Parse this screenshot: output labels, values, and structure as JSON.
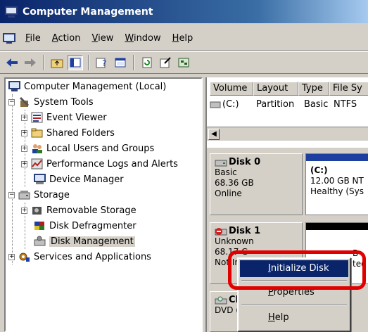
{
  "window": {
    "title": "Computer Management"
  },
  "menu": [
    {
      "label": "File",
      "key": "F",
      "rest": "ile"
    },
    {
      "label": "Action",
      "key": "A",
      "rest": "ction"
    },
    {
      "label": "View",
      "key": "V",
      "rest": "iew"
    },
    {
      "label": "Window",
      "key": "W",
      "rest": "indow"
    },
    {
      "label": "Help",
      "key": "H",
      "rest": "elp"
    }
  ],
  "toolbar": {
    "icons": [
      "back-icon",
      "forward-icon",
      "up-folder-icon",
      "show-hide-tree-icon",
      "help-icon",
      "properties-icon",
      "refresh-icon",
      "export-icon",
      "console-icon"
    ]
  },
  "tree": {
    "root": "Computer Management (Local)",
    "system_tools": "System Tools",
    "event_viewer": "Event Viewer",
    "shared_folders": "Shared Folders",
    "local_users": "Local Users and Groups",
    "perf_logs": "Performance Logs and Alerts",
    "device_manager": "Device Manager",
    "storage": "Storage",
    "removable_storage": "Removable Storage",
    "disk_defrag": "Disk Defragmenter",
    "disk_management": "Disk Management",
    "services": "Services and Applications"
  },
  "volume_list": {
    "columns": [
      "Volume",
      "Layout",
      "Type",
      "File Sy"
    ],
    "rows": [
      {
        "volume": "(C:)",
        "layout": "Partition",
        "type": "Basic",
        "fs": "NTFS"
      }
    ]
  },
  "disks": {
    "disk0": {
      "name": "Disk 0",
      "type": "Basic",
      "size": "68.36 GB",
      "status": "Online",
      "partition": {
        "label": "(C:)",
        "size": "12.00 GB NT",
        "status": "Healthy (Sys"
      }
    },
    "disk1": {
      "name": "Disk 1",
      "type": "Unknown",
      "size": "68.17 G",
      "status": "Not Init",
      "partition_size_fragment": "B",
      "partition_status_fragment": "ted"
    },
    "cdrom": {
      "name": "CD-",
      "type": "DVD (E:"
    }
  },
  "context_menu": {
    "items": [
      {
        "label": "Initialize Disk",
        "key": "I",
        "rest": "nitialize Disk"
      },
      {
        "label": "Properties",
        "key": "P",
        "rest": "roperties"
      },
      {
        "label": "Help",
        "key": "H",
        "rest": "elp"
      }
    ]
  },
  "colors": {
    "title_bar": "#0a246a",
    "highlight": "#0a246a",
    "annotation_ring": "#e00000",
    "disk_bar_basic": "#1f3fa0",
    "disk_bar_unalloc": "#000000"
  }
}
